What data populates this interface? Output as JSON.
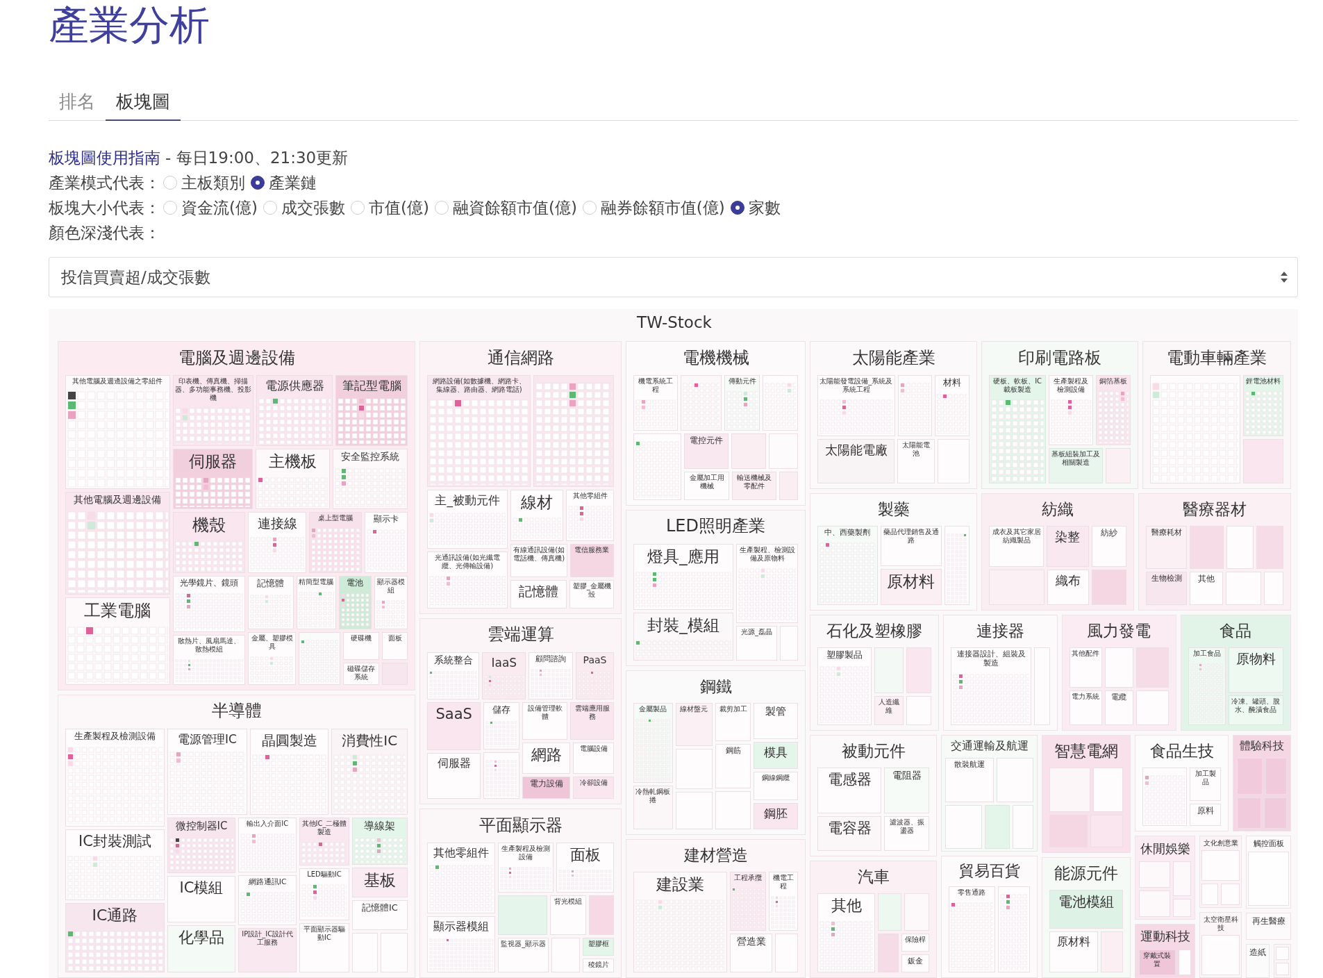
{
  "page_title": "產業分析",
  "tabs": [
    {
      "label": "排名",
      "selected": false
    },
    {
      "label": "板塊圖",
      "selected": true
    }
  ],
  "guide": {
    "link": "板塊圖使用指南",
    "note": "- 每日19:00、21:30更新"
  },
  "option_groups": [
    {
      "label": "產業模式代表：",
      "options": [
        {
          "label": "主板類別",
          "selected": false
        },
        {
          "label": "產業鏈",
          "selected": true
        }
      ]
    },
    {
      "label": "板塊大小代表：",
      "options": [
        {
          "label": "資金流(億)",
          "selected": false
        },
        {
          "label": "成交張數",
          "selected": false
        },
        {
          "label": "市值(億)",
          "selected": false
        },
        {
          "label": "融資餘額市值(億)",
          "selected": false
        },
        {
          "label": "融券餘額市值(億)",
          "selected": false
        },
        {
          "label": "家數",
          "selected": true
        }
      ]
    },
    {
      "label": "顏色深淺代表："
    }
  ],
  "color_metric_select": {
    "value": "投信買賣超/成交張數"
  },
  "treemap": {
    "title": "TW-Stock",
    "sectors": [
      {
        "name": "電腦及週邊設備",
        "color": "#fcecf2",
        "industries": [
          {
            "name": "其他電腦及週邊設備之零組件",
            "color": "#fdfafb"
          },
          {
            "name": "印表機、傳真機、掃描器、多功能事務機、投影機",
            "color": "#f9e6ee"
          },
          {
            "name": "電源供應器",
            "color": "#f9e6ee"
          },
          {
            "name": "筆記型電腦",
            "color": "#f2cfdd"
          },
          {
            "name": "伺服器",
            "color": "#f2cfdd"
          },
          {
            "name": "主機板",
            "color": "#fdf8fa"
          },
          {
            "name": "安全監控系統",
            "color": "#fdf8fa"
          },
          {
            "name": "其他電腦及週邊設備",
            "color": "#f9e6ee"
          },
          {
            "name": "機殼",
            "color": "#f9e6ee"
          },
          {
            "name": "連接線",
            "color": "#fefcfd"
          },
          {
            "name": "桌上型電腦",
            "color": "#f7e1ea"
          },
          {
            "name": "顯示卡",
            "color": "#fefcfd"
          },
          {
            "name": "光學鏡片、鏡頭",
            "color": "#fefcfd"
          },
          {
            "name": "記憶體",
            "color": "#fefcfd"
          },
          {
            "name": "精簡型電腦",
            "color": "#fefcfd"
          },
          {
            "name": "電池",
            "color": "#cdebd7"
          },
          {
            "name": "顯示器模組",
            "color": "#fefcfd"
          },
          {
            "name": "工業電腦",
            "color": "#fdf9fb"
          },
          {
            "name": "散熱片、風扇馬達、散熱模組",
            "color": "#fefcfd"
          },
          {
            "name": "金屬、塑膠模具",
            "color": "#fefcfd"
          },
          {
            "color": "#f9fcfa"
          },
          {
            "name": "硬碟機",
            "color": "#fefcfd"
          },
          {
            "name": "面板",
            "color": "#fefcfd"
          },
          {
            "name": "磁碟儲存系統",
            "color": "#fefcfd"
          },
          {
            "color": "#f8e6ee"
          }
        ]
      },
      {
        "name": "通信網路",
        "color": "#fcf3f6",
        "industries": [
          {
            "name": "網路設備(如數據機、網路卡、集線器、路由器、網路電話)",
            "color": "#f9e8ef"
          },
          {
            "color": "#f9e6ee"
          },
          {
            "name": "主_被動元件",
            "color": "#fefcfd"
          },
          {
            "name": "線材",
            "color": "#fefcfd"
          },
          {
            "name": "其他零組件",
            "color": "#fefcfd"
          },
          {
            "name": "光通訊設備(如光纖電纜、光傳輸設備)",
            "color": "#fefcfd"
          },
          {
            "name": "有線通訊設備(如電話機、傳真機)",
            "color": "#fefcfd"
          },
          {
            "name": "電信服務業",
            "color": "#f4d7e3"
          },
          {
            "name": "記憶體",
            "color": "#fefcfd"
          },
          {
            "name": "塑膠_金屬機殼",
            "color": "#fefcfd"
          }
        ]
      },
      {
        "name": "電機機械",
        "color": "#fcfafb",
        "industries": [
          {
            "name": "機電系統工程",
            "color": "#fefcfd"
          },
          {
            "color": "#fcf8fa"
          },
          {
            "name": "傳動元件",
            "color": "#f6fbf8"
          },
          {
            "color": "#fefcfd"
          },
          {
            "color": "#fefcfd"
          },
          {
            "name": "電控元件",
            "color": "#f9e8ef"
          },
          {
            "color": "#fbeef3"
          },
          {
            "color": "#fdfbfc"
          },
          {
            "name": "金屬加工用機械",
            "color": "#fefcfd"
          },
          {
            "name": "輸送機械及零配件",
            "color": "#fbeef3"
          },
          {
            "color": "#fbeef3"
          }
        ]
      },
      {
        "name": "太陽能產業",
        "color": "#fcf9fa",
        "industries": [
          {
            "name": "太陽能發電設備_系統及系統工程",
            "color": "#fefcfd"
          },
          {
            "color": "#fdfbfc"
          },
          {
            "name": "材料",
            "color": "#fefcfd"
          },
          {
            "name": "太陽能電廠",
            "color": "#f8f3f5"
          },
          {
            "name": "太陽能電池",
            "color": "#fefcfd"
          },
          {
            "color": "#fefcfd"
          }
        ]
      },
      {
        "name": "印刷電路板",
        "color": "#f5faf7",
        "industries": [
          {
            "name": "硬板、軟板、IC載板製造",
            "color": "#e4f5ea"
          },
          {
            "name": "生產製程及檢測設備",
            "color": "#fefcfd"
          },
          {
            "name": "銅箔基板",
            "color": "#f9e6ee"
          },
          {
            "name": "基板組裝加工及相關製造",
            "color": "#e9f6ee"
          },
          {
            "color": "#fbf0f4"
          }
        ]
      },
      {
        "name": "電動車輛產業",
        "color": "#fbf6f8",
        "industries": [
          {
            "color": "#fdfbfc"
          },
          {
            "name": "鋰電池材料",
            "color": "#e4f5ea"
          },
          {
            "color": "#f9e6ee"
          }
        ]
      },
      {
        "name": "LED照明產業",
        "color": "#fbf8f9",
        "industries": [
          {
            "name": "燈具_應用",
            "color": "#fefcfd"
          },
          {
            "name": "生產製程、檢測設備及原物料",
            "color": "#fefcfd"
          },
          {
            "name": "封裝_模組",
            "color": "#fbf8f9"
          },
          {
            "name": "光源_磊晶",
            "color": "#fefcfd"
          },
          {
            "color": "#fefcfd"
          }
        ]
      },
      {
        "name": "製藥",
        "color": "#fafbfa",
        "industries": [
          {
            "name": "中、西藥製劑",
            "color": "#f6fbf8"
          },
          {
            "name": "藥品代理銷售及通路",
            "color": "#fefcfd"
          },
          {
            "name": "原材料",
            "color": "#fbeff4"
          },
          {
            "color": "#fefcfd"
          }
        ]
      },
      {
        "name": "紡織",
        "color": "#fbeef3",
        "industries": [
          {
            "name": "成衣及其它家居紡織製品",
            "color": "#fefcfd"
          },
          {
            "name": "染整",
            "color": "#f9e8ef"
          },
          {
            "name": "紡紗",
            "color": "#fefcfd"
          },
          {
            "color": "#fbf0f4"
          },
          {
            "name": "織布",
            "color": "#fefcfd"
          },
          {
            "color": "#f4d7e3"
          }
        ]
      },
      {
        "name": "醫療器材",
        "color": "#fbf1f5",
        "industries": [
          {
            "name": "醫療耗材",
            "color": "#fbf0f4"
          },
          {
            "color": "#f6dce7"
          },
          {
            "color": "#fefcfd"
          },
          {
            "color": "#f6dce7"
          },
          {
            "name": "生物檢測",
            "color": "#f8e6ee"
          },
          {
            "name": "其他",
            "color": "#fefcfd"
          },
          {
            "color": "#fefcfd"
          },
          {
            "color": "#fefcfd"
          }
        ]
      },
      {
        "name": "雲端運算",
        "color": "#fbf5f7",
        "industries": [
          {
            "name": "系統整合",
            "color": "#fefcfd"
          },
          {
            "name": "IaaS",
            "color": "#faebf1"
          },
          {
            "name": "顧問諮詢",
            "color": "#fefcfd"
          },
          {
            "name": "PaaS",
            "color": "#faebf1"
          },
          {
            "name": "SaaS",
            "color": "#f9e6ee"
          },
          {
            "name": "伺服器",
            "color": "#fefcfd"
          },
          {
            "name": "儲存",
            "color": "#fefcfd"
          },
          {
            "color": "#fefcfd"
          },
          {
            "name": "設備管理軟體",
            "color": "#fefcfd"
          },
          {
            "name": "雲端應用服務",
            "color": "#f9e6ee"
          },
          {
            "name": "網路",
            "color": "#fefcfd"
          },
          {
            "name": "電腦設備",
            "color": "#fefcfd"
          },
          {
            "name": "電力設備",
            "color": "#efc6d7"
          },
          {
            "name": "冷卻設備",
            "color": "#f9e6ee"
          }
        ]
      },
      {
        "name": "石化及塑橡膠",
        "color": "#fbf8f9",
        "industries": [
          {
            "name": "塑膠製品",
            "color": "#fefcfd"
          },
          {
            "color": "#f3faf5"
          },
          {
            "color": "#f9e6ee"
          },
          {
            "name": "人造纖維",
            "color": "#fbf0f4"
          },
          {
            "color": "#fefcfd"
          }
        ]
      },
      {
        "name": "連接器",
        "color": "#fcfafb",
        "industries": [
          {
            "name": "連接器設計、組裝及製造",
            "color": "#fefcfd"
          },
          {
            "color": "#fefcfd"
          }
        ]
      },
      {
        "name": "風力發電",
        "color": "#faecf2",
        "industries": [
          {
            "name": "其他配件",
            "color": "#fefcfd"
          },
          {
            "color": "#fefcfd"
          },
          {
            "color": "#f6dce7"
          },
          {
            "name": "電力系統",
            "color": "#fefcfd"
          },
          {
            "name": "電纜",
            "color": "#fefcfd"
          },
          {
            "color": "#fefcfd"
          }
        ]
      },
      {
        "name": "食品",
        "color": "#e2f3e7",
        "industries": [
          {
            "name": "加工食品",
            "color": "#eef9f1"
          },
          {
            "name": "原物料",
            "color": "#eef9f1"
          },
          {
            "name": "冷凍、罐頭、脫水、醃漬食品",
            "color": "#eef9f1"
          }
        ]
      },
      {
        "name": "半導體",
        "color": "#fcf7f9",
        "industries": [
          {
            "name": "生產製程及檢測設備",
            "color": "#fefcfd"
          },
          {
            "name": "電源管理IC",
            "color": "#fefcfd"
          },
          {
            "name": "晶圓製造",
            "color": "#fefcfd"
          },
          {
            "name": "消費性IC",
            "color": "#fbf4f7"
          },
          {
            "name": "IC封裝測試",
            "color": "#fefcfd"
          },
          {
            "name": "IC通路",
            "color": "#f8e6ee"
          },
          {
            "name": "微控制器IC",
            "color": "#f8e6ee"
          },
          {
            "name": "輸出入介面IC",
            "color": "#fefcfd"
          },
          {
            "name": "其他IC_二極體製造",
            "color": "#f9e8ef"
          },
          {
            "name": "導線架",
            "color": "#e4f5ea"
          },
          {
            "name": "IC模組",
            "color": "#fefcfd"
          },
          {
            "name": "網路通訊IC",
            "color": "#fefcfd"
          },
          {
            "name": "LED驅動IC",
            "color": "#fefcfd"
          },
          {
            "name": "基板",
            "color": "#f9ebf1"
          },
          {
            "name": "記憶體IC",
            "color": "#fefcfd"
          },
          {
            "name": "化學品",
            "color": "#f4faf6"
          },
          {
            "name": "IP設計_IC設計代工服務",
            "color": "#f9e8ef"
          },
          {
            "name": "平面顯示器驅動IC",
            "color": "#fefcfd"
          },
          {
            "color": "#fefcfd"
          },
          {
            "color": "#fefcfd"
          }
        ]
      },
      {
        "name": "鋼鐵",
        "color": "#fafafa",
        "industries": [
          {
            "name": "金屬製品",
            "color": "#f4fbf7"
          },
          {
            "name": "線材盤元",
            "color": "#fbf0f4"
          },
          {
            "name": "裁剪加工",
            "color": "#fefcfd"
          },
          {
            "name": "製管",
            "color": "#fefcfd"
          },
          {
            "color": "#fefcfd"
          },
          {
            "name": "鋼筋",
            "color": "#fefcfd"
          },
          {
            "name": "模具",
            "color": "#e4f5ea"
          },
          {
            "name": "鋼線鋼纜",
            "color": "#fefcfd"
          },
          {
            "name": "冷熱軋鋼板捲",
            "color": "#fbf6f8"
          },
          {
            "color": "#fefcfd"
          },
          {
            "color": "#fefcfd"
          },
          {
            "name": "鋼胚",
            "color": "#f9e6ee"
          }
        ]
      },
      {
        "name": "被動元件",
        "color": "#fbf9fa",
        "industries": [
          {
            "name": "電感器",
            "color": "#fefcfd"
          },
          {
            "name": "電阻器",
            "color": "#f6fbf8"
          },
          {
            "name": "電容器",
            "color": "#fbf7f9"
          },
          {
            "name": "濾波器、振盪器",
            "color": "#fefcfd"
          }
        ]
      },
      {
        "name": "交通運輸及航運",
        "color": "#f7fbf8",
        "industries": [
          {
            "name": "散裝航運",
            "color": "#fefcfd"
          },
          {
            "color": "#fefcfd"
          },
          {
            "color": "#fefcfd"
          },
          {
            "color": "#e4f5ea"
          },
          {
            "color": "#fefcfd"
          }
        ]
      },
      {
        "name": "智慧電網",
        "color": "#f8e1ea",
        "industries": [
          {
            "color": "#fdf6f9"
          },
          {
            "color": "#fefcfd"
          },
          {
            "color": "#f4d7e3"
          },
          {
            "color": "#f9e6ee"
          }
        ]
      },
      {
        "name": "食品生技",
        "color": "#fdfcfc",
        "industries": [
          {
            "color": "#fefcfd"
          },
          {
            "name": "加工製品",
            "color": "#fefcfd"
          },
          {
            "name": "原料",
            "color": "#fefcfd"
          }
        ]
      },
      {
        "name": "體驗科技",
        "color": "#f5d6e3",
        "industries": [
          {
            "color": "#f1cbdb"
          },
          {
            "color": "#f1cbdb"
          },
          {
            "color": "#f1cbdb"
          },
          {
            "color": "#f1cbdb"
          }
        ]
      },
      {
        "name": "平面顯示器",
        "color": "#fbf7f8",
        "industries": [
          {
            "name": "其他零組件",
            "color": "#fefcfd"
          },
          {
            "name": "生產製程及檢測設備",
            "color": "#fefcfd"
          },
          {
            "name": "面板",
            "color": "#fefcfd"
          },
          {
            "name": "顯示器模組",
            "color": "#fefcfd"
          },
          {
            "color": "#e6f5eb"
          },
          {
            "name": "背光模組",
            "color": "#fefcfd"
          },
          {
            "color": "#f6d9e5"
          },
          {
            "name": "監視器_顯示器",
            "color": "#fefcfd"
          },
          {
            "color": "#fefcfd"
          },
          {
            "name": "塑膠框",
            "color": "#e4f5ea"
          },
          {
            "name": "稜鏡片",
            "color": "#fefcfd"
          }
        ]
      },
      {
        "name": "建材營造",
        "color": "#fcf6f8",
        "industries": [
          {
            "name": "建設業",
            "color": "#fdf8fa"
          },
          {
            "name": "工程承攬",
            "color": "#f9ebf1"
          },
          {
            "name": "機電工程",
            "color": "#fefcfd"
          },
          {
            "name": "營造業",
            "color": "#fefcfd"
          },
          {
            "color": "#fefcfd"
          }
        ]
      },
      {
        "name": "汽車",
        "color": "#fbf1f5",
        "industries": [
          {
            "name": "其他",
            "color": "#fefcfd"
          },
          {
            "color": "#edf8f1"
          },
          {
            "color": "#fdf8fa"
          },
          {
            "color": "#f6dce7"
          },
          {
            "name": "保險桿",
            "color": "#fefcfd"
          },
          {
            "name": "鈑金",
            "color": "#fefcfd"
          }
        ]
      },
      {
        "name": "貿易百貨",
        "color": "#fcfafb",
        "industries": [
          {
            "name": "零售通路",
            "color": "#fefcfd"
          },
          {
            "color": "#fefcfd"
          }
        ]
      },
      {
        "name": "能源元件",
        "color": "#f5faf7",
        "industries": [
          {
            "name": "電池模組",
            "color": "#dff2e6"
          },
          {
            "name": "原材料",
            "color": "#fefcfd"
          },
          {
            "color": "#fbeff4"
          }
        ]
      },
      {
        "name": "休閒娛樂",
        "color": "#faecf2",
        "industries": [
          {
            "color": "#fdf8fa"
          },
          {
            "color": "#fdf8fa"
          },
          {
            "color": "#fdf8fa"
          },
          {
            "color": "#fdf8fa"
          }
        ]
      },
      {
        "name": "文化創意業",
        "color": "#fbf3f6",
        "industries": [
          {
            "color": "#fefcfd"
          },
          {
            "color": "#fefcfd"
          },
          {
            "color": "#fefcfd"
          }
        ]
      },
      {
        "name": "觸控面板",
        "color": "#fcfafb",
        "industries": [
          {
            "color": "#fefefe"
          }
        ]
      },
      {
        "name": "再生醫療",
        "color": "#fcfafb"
      },
      {
        "name": "造紙",
        "color": "#fcfbfb"
      },
      {
        "color": "#fbf5f8",
        "industries": [
          {
            "color": "#fefcfd"
          },
          {
            "color": "#fefcfd"
          }
        ]
      },
      {
        "name": "運動科技",
        "color": "#f5d9e5",
        "industries": [
          {
            "name": "穿戴式裝置",
            "color": "#efc6d7"
          },
          {
            "color": "#fefcfd"
          }
        ]
      },
      {
        "name": "太空衛星科技",
        "color": "#fbf5f7",
        "industries": [
          {
            "color": "#fefcfd"
          }
        ]
      }
    ]
  }
}
